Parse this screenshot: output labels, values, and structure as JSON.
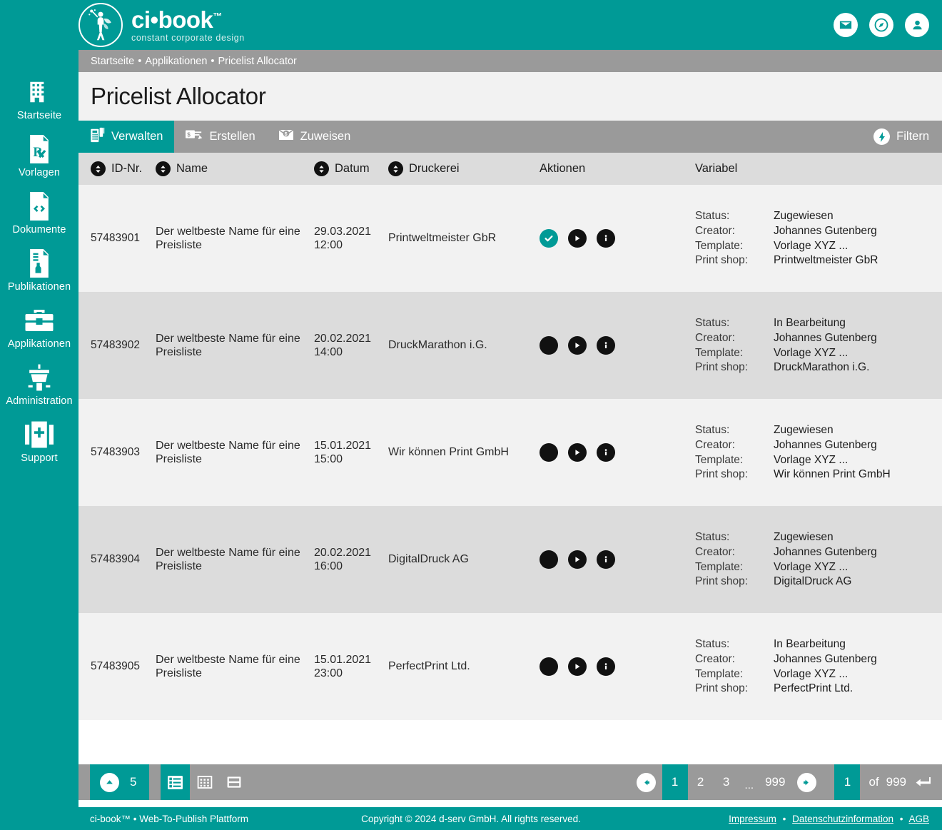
{
  "brand": {
    "name": "ci•book",
    "tm": "™",
    "tagline": "constant corporate design",
    "logo_icon": "fairy-logo-icon"
  },
  "topbar": {
    "icons": [
      {
        "name": "mail-icon",
        "label": "Nachrichten"
      },
      {
        "name": "compass-icon",
        "label": "Navigator"
      },
      {
        "name": "user-icon",
        "label": "Benutzerkonto"
      }
    ]
  },
  "breadcrumb": {
    "items": [
      "Startseite",
      "Applikationen",
      "Pricelist Allocator"
    ],
    "separator": "•"
  },
  "page": {
    "title": "Pricelist Allocator"
  },
  "tabs": [
    {
      "label": "Verwalten",
      "icon": "manage-grid-icon",
      "active": true
    },
    {
      "label": "Erstellen",
      "icon": "create-invoice-icon",
      "active": false
    },
    {
      "label": "Zuweisen",
      "icon": "assign-envelope-icon",
      "active": false
    }
  ],
  "filter": {
    "label": "Filtern",
    "icon": "filter-bolt-icon"
  },
  "table": {
    "columns": [
      {
        "key": "id",
        "label": "ID-Nr.",
        "sortable": true
      },
      {
        "key": "name",
        "label": "Name",
        "sortable": true
      },
      {
        "key": "date",
        "label": "Datum",
        "sortable": true
      },
      {
        "key": "printer",
        "label": "Druckerei",
        "sortable": true
      },
      {
        "key": "actions",
        "label": "Aktionen",
        "sortable": false
      },
      {
        "key": "variable",
        "label": "Variabel",
        "sortable": false
      }
    ],
    "variable_labels": {
      "status": "Status:",
      "creator": "Creator:",
      "template": "Template:",
      "print_shop": "Print shop:"
    },
    "rows": [
      {
        "id": "57483901",
        "name": "Der weltbeste Name für eine Preisliste",
        "date": "29.03.2021",
        "time": "12:00",
        "printer": "Printweltmeister GbR",
        "actions": [
          {
            "name": "approve-check-button",
            "icon": "check-icon",
            "accent": true
          },
          {
            "name": "run-play-button",
            "icon": "play-icon",
            "accent": false
          },
          {
            "name": "info-button",
            "icon": "info-icon",
            "accent": false
          }
        ],
        "variable": {
          "status": "Zugewiesen",
          "creator": "Johannes Gutenberg",
          "template": "Vorlage XYZ ...",
          "print_shop": "Printweltmeister GbR"
        }
      },
      {
        "id": "57483902",
        "name": "Der weltbeste Name für eine Preisliste",
        "date": "20.02.2021",
        "time": "14:00",
        "printer": "DruckMarathon i.G.",
        "actions": [
          {
            "name": "approve-check-button",
            "icon": "blank-circle-icon",
            "accent": false
          },
          {
            "name": "run-play-button",
            "icon": "play-icon",
            "accent": false
          },
          {
            "name": "info-button",
            "icon": "info-icon",
            "accent": false
          }
        ],
        "variable": {
          "status": "In Bearbeitung",
          "creator": "Johannes Gutenberg",
          "template": "Vorlage XYZ ...",
          "print_shop": "DruckMarathon i.G."
        }
      },
      {
        "id": "57483903",
        "name": "Der weltbeste Name für eine Preisliste",
        "date": "15.01.2021",
        "time": "15:00",
        "printer": "Wir können Print GmbH",
        "actions": [
          {
            "name": "approve-check-button",
            "icon": "blank-circle-icon",
            "accent": false
          },
          {
            "name": "run-play-button",
            "icon": "play-icon",
            "accent": false
          },
          {
            "name": "info-button",
            "icon": "info-icon",
            "accent": false
          }
        ],
        "variable": {
          "status": "Zugewiesen",
          "creator": "Johannes Gutenberg",
          "template": "Vorlage XYZ ...",
          "print_shop": "Wir können Print GmbH"
        }
      },
      {
        "id": "57483904",
        "name": "Der weltbeste Name für eine Preisliste",
        "date": "20.02.2021",
        "time": "16:00",
        "printer": "DigitalDruck AG",
        "actions": [
          {
            "name": "approve-check-button",
            "icon": "blank-circle-icon",
            "accent": false
          },
          {
            "name": "run-play-button",
            "icon": "play-icon",
            "accent": false
          },
          {
            "name": "info-button",
            "icon": "info-icon",
            "accent": false
          }
        ],
        "variable": {
          "status": "Zugewiesen",
          "creator": "Johannes Gutenberg",
          "template": "Vorlage XYZ ...",
          "print_shop": "DigitalDruck AG"
        }
      },
      {
        "id": "57483905",
        "name": "Der weltbeste Name für eine Preisliste",
        "date": "15.01.2021",
        "time": "23:00",
        "printer": "PerfectPrint Ltd.",
        "actions": [
          {
            "name": "approve-check-button",
            "icon": "blank-circle-icon",
            "accent": false
          },
          {
            "name": "run-play-button",
            "icon": "play-icon",
            "accent": false
          },
          {
            "name": "info-button",
            "icon": "info-icon",
            "accent": false
          }
        ],
        "variable": {
          "status": "In Bearbeitung",
          "creator": "Johannes Gutenberg",
          "template": "Vorlage XYZ ...",
          "print_shop": "PerfectPrint Ltd."
        }
      }
    ]
  },
  "pagination": {
    "page_size": "5",
    "page_size_icon": "caret-up-icon",
    "views": [
      {
        "name": "list-view-icon",
        "active": true
      },
      {
        "name": "grid-view-icon",
        "active": false
      },
      {
        "name": "split-view-icon",
        "active": false
      }
    ],
    "prev_icon": "arrow-left-icon",
    "next_icon": "arrow-right-icon",
    "pages": [
      "1",
      "2",
      "3"
    ],
    "ellipsis": "...",
    "last_page": "999",
    "current_page": "1",
    "jump_value": "1",
    "of_label": "of",
    "total_pages": "999",
    "enter_icon": "enter-key-icon"
  },
  "sidebar": {
    "items": [
      {
        "label": "Startseite",
        "icon": "home-building-icon"
      },
      {
        "label": "Vorlagen",
        "icon": "template-rx-icon"
      },
      {
        "label": "Dokumente",
        "icon": "document-code-icon"
      },
      {
        "label": "Publikationen",
        "icon": "publication-icon"
      },
      {
        "label": "Applikationen",
        "icon": "toolbox-icon"
      },
      {
        "label": "Administration",
        "icon": "control-tower-icon"
      },
      {
        "label": "Support",
        "icon": "first-aid-icon"
      }
    ]
  },
  "footer": {
    "left": "ci-book™ • Web-To-Publish Plattform",
    "center": "Copyright © 2024 d-serv GmbH. All rights reserved.",
    "links": [
      "Impressum",
      "Datenschutzinformation",
      "AGB"
    ],
    "link_separator": "•"
  },
  "colors": {
    "accent": "#009a96",
    "gray_bar": "#9a9a9a",
    "row_odd": "#f2f2f2",
    "row_even": "#dcdcdc",
    "icon_dark": "#111111"
  }
}
